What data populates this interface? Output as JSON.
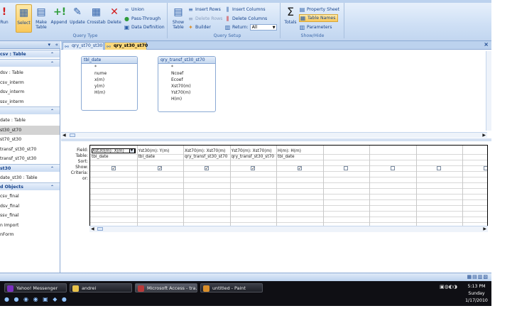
{
  "ribbon": {
    "run_label": "Run",
    "select_label": "Select",
    "make_table_label": "Make Table",
    "append_label": "Append",
    "update_label": "Update",
    "crosstab_label": "Crosstab",
    "delete_label": "Delete",
    "union_label": "Union",
    "passthrough_label": "Pass-Through",
    "data_definition_label": "Data Definition",
    "query_type_group": "Query Type",
    "show_table_label": "Show Table",
    "insert_rows_label": "Insert Rows",
    "delete_rows_label": "Delete Rows",
    "builder_label": "Builder",
    "insert_columns_label": "Insert Columns",
    "delete_columns_label": "Delete Columns",
    "return_label": "Return:",
    "return_value": "All",
    "query_setup_group": "Query Setup",
    "totals_label": "Totals",
    "property_sheet_label": "Property Sheet",
    "table_names_label": "Table Names",
    "parameters_label": "Parameters",
    "show_hide_group": "Show/Hide"
  },
  "nav": {
    "items": [
      {
        "kind": "group",
        "label": "csv : Table"
      },
      {
        "kind": "group",
        "label": ""
      },
      {
        "kind": "item",
        "label": "dsv : Table"
      },
      {
        "kind": "item",
        "label": "csv_interm"
      },
      {
        "kind": "item",
        "label": "dsv_interm"
      },
      {
        "kind": "item",
        "label": "ssv_interm"
      },
      {
        "kind": "group",
        "label": ""
      },
      {
        "kind": "item",
        "label": "date : Table"
      },
      {
        "kind": "item",
        "label": "st30_st70"
      },
      {
        "kind": "item",
        "label": "st70_st30"
      },
      {
        "kind": "item",
        "label": "transf_st30_st70"
      },
      {
        "kind": "item",
        "label": "transf_st70_st30"
      },
      {
        "kind": "group",
        "label": "st30"
      },
      {
        "kind": "item",
        "label": "date_st30 : Table"
      },
      {
        "kind": "group",
        "label": "d Objects"
      },
      {
        "kind": "item",
        "label": "csv_final"
      },
      {
        "kind": "item",
        "label": "dsv_final"
      },
      {
        "kind": "item",
        "label": "ssv_final"
      },
      {
        "kind": "item",
        "label": "n Import"
      },
      {
        "kind": "item",
        "label": "nForm"
      }
    ]
  },
  "tabs": [
    {
      "label": "qry_st70_st30"
    },
    {
      "label": "qry_st30_st70"
    }
  ],
  "tables": [
    {
      "title": "tbl_date",
      "fields": [
        "*",
        "nume",
        "x(m)",
        "y(m)",
        "H(m)"
      ]
    },
    {
      "title": "qry_transf_st30_st70",
      "fields": [
        "*",
        "Ncoef",
        "Ecoef",
        "Xst70(m)",
        "Yst70(m)",
        "H(m)"
      ]
    }
  ],
  "grid": {
    "row_labels": [
      "Field:",
      "Table:",
      "Sort:",
      "Show:",
      "Criteria:",
      "or:"
    ],
    "columns": [
      {
        "field": "Xst30(m): X(m)",
        "table": "tbl_date",
        "show": true
      },
      {
        "field": "Yst30(m): Y(m)",
        "table": "tbl_date",
        "show": true
      },
      {
        "field": "Xst70(m): Xst70(m)",
        "table": "qry_transf_st30_st70",
        "show": true
      },
      {
        "field": "Yst70(m): Xst70(m)",
        "table": "qry_transf_st30_st70",
        "show": true
      },
      {
        "field": "H(m): H(m)",
        "table": "tbl_date",
        "show": true
      },
      {
        "field": "",
        "table": "",
        "show": false
      },
      {
        "field": "",
        "table": "",
        "show": false
      },
      {
        "field": "",
        "table": "",
        "show": false
      },
      {
        "field": "",
        "table": "",
        "show": false
      }
    ]
  },
  "taskbar": {
    "buttons": [
      {
        "label": "Yahoo! Messenger",
        "color": "#7b2fbf"
      },
      {
        "label": "andrei",
        "color": "#e8c24a"
      },
      {
        "label": "Microsoft Access - tra...",
        "color": "#b83a3a"
      },
      {
        "label": "untitled - Paint",
        "color": "#d98e2a"
      }
    ],
    "time": "5:13 PM",
    "day": "Sunday",
    "date": "1/17/2010"
  }
}
